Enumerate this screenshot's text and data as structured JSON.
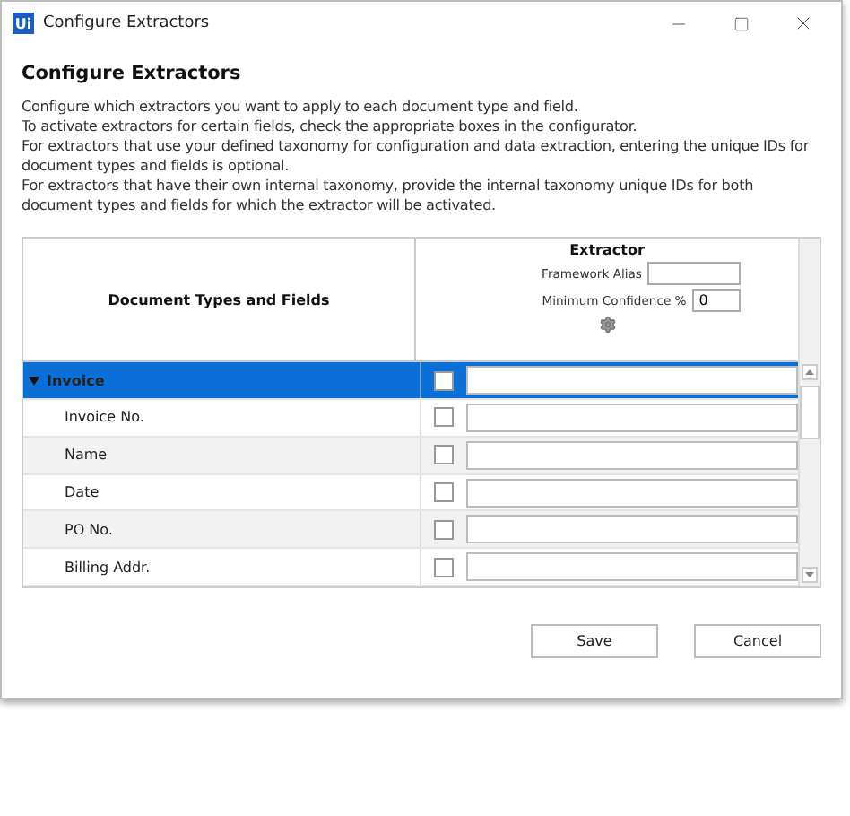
{
  "window": {
    "title": "Configure Extractors",
    "app_icon": "Ui"
  },
  "heading": "Configure Extractors",
  "description": [
    "Configure which extractors you want to apply to each document type and field.",
    "To activate extractors for certain fields, check the appropriate boxes in the configurator.",
    "For extractors that use your defined taxonomy for configuration and data extraction, entering the unique IDs for document types and fields is optional.",
    "For extractors that have their own internal taxonomy, provide the internal taxonomy unique IDs for both document types and fields for which the extractor will be activated."
  ],
  "table": {
    "column": "Document Types and Fields",
    "extractor": {
      "title": "Extractor",
      "framework_alias_label": "Framework Alias",
      "min_confidence_label": "Minimum Confidence %",
      "min_confidence": "0"
    },
    "rows": [
      {
        "label": "Invoice",
        "selected": true,
        "expanded": true,
        "checked": false,
        "children": [
          {
            "label": "Invoice No.",
            "selected": false,
            "checked": false
          },
          {
            "label": "Name",
            "selected": false,
            "checked": false
          },
          {
            "label": "Date",
            "selected": false,
            "checked": false
          },
          {
            "label": "PO No.",
            "selected": false,
            "checked": false
          },
          {
            "label": "Billing Addr.",
            "selected": false,
            "checked": false
          }
        ]
      }
    ]
  },
  "buttons": [
    "Save",
    "Cancel"
  ]
}
